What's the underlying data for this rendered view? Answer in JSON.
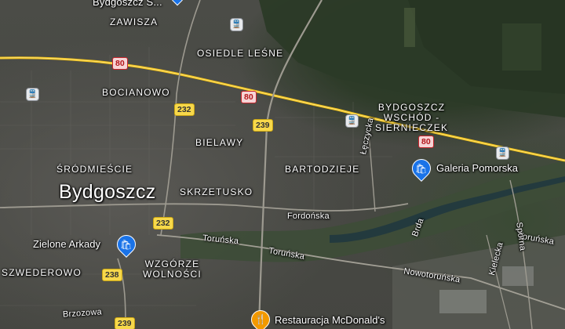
{
  "map": {
    "type": "satellite",
    "city": "Bydgoszcz",
    "top_cut_label": "Bydgoszcz Ś...",
    "districts": {
      "zawisza": "ZAWISZA",
      "osiedle_lesne": "OSIEDLE LEŚNE",
      "bocianowo": "BOCIANOWO",
      "wschod_line1": "BYDGOSZCZ",
      "wschod_line2": "WSCHÓD -",
      "wschod_line3": "SIERNIECZEK",
      "bielawy": "BIELAWY",
      "srodmiescie": "ŚRÓDMIEŚCIE",
      "bartodzieje": "BARTODZIEJE",
      "skrzetusko": "SKRZETUSKO",
      "wzgorze_line1": "WZGÓRZE",
      "wzgorze_line2": "WOLNOŚCI",
      "szwederowo": "SZWEDEROWO"
    },
    "streets": {
      "leczycka": "Łęczycka",
      "fordonska": "Fordońska",
      "torunska1": "Toruńska",
      "torunska2": "Toruńska",
      "torunska3": "Toruńska",
      "nowotorunska": "Nowotoruńska",
      "brda": "Brda",
      "sporna": "Sporna",
      "kielecka": "Kielecka",
      "brzozowa": "Brzozowa"
    },
    "road_shields": {
      "r80a": "80",
      "r80b": "80",
      "r80c": "80",
      "r232a": "232",
      "r232b": "232",
      "r239a": "239",
      "r239b": "239",
      "r238": "238"
    },
    "pois": {
      "galeria": "Galeria Pomorska",
      "zielone": "Zielone Arkady",
      "mcdonalds": "Restauracja McDonald's"
    },
    "icons": {
      "shopping": "shopping-bag-icon",
      "restaurant": "fork-knife-icon",
      "transit": "train-icon"
    },
    "colors": {
      "poi_blue": "#1a73e8",
      "poi_orange": "#f29900",
      "road_red": "#c9252c",
      "road_yellow": "#f7d84a"
    }
  }
}
